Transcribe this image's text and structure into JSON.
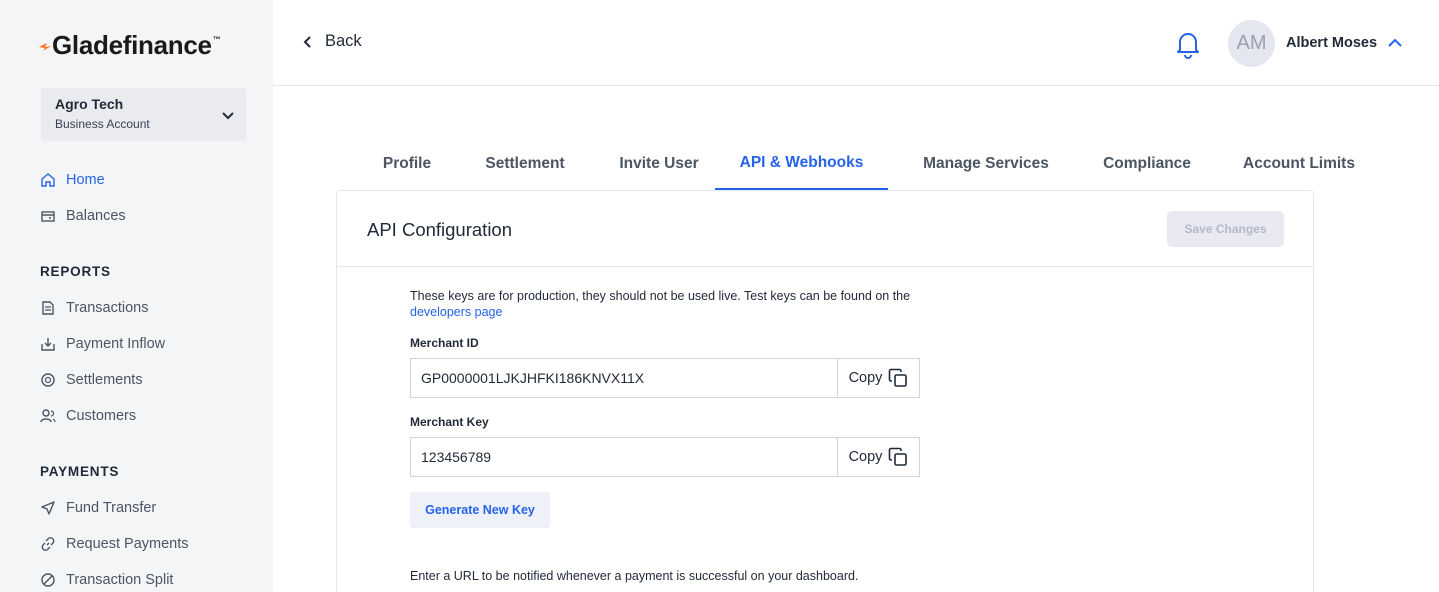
{
  "brand": {
    "name": "Gladefinance",
    "trademark": "™",
    "accent_color": "#2563eb",
    "logo_mark_color": "#f97316"
  },
  "account": {
    "name": "Agro Tech",
    "type": "Business Account"
  },
  "sidebar": {
    "main_items": [
      {
        "label": "Home",
        "icon": "home-icon",
        "active": true
      },
      {
        "label": "Balances",
        "icon": "wallet-icon",
        "active": false
      }
    ],
    "reports_title": "REPORTS",
    "reports_items": [
      {
        "label": "Transactions",
        "icon": "document-icon"
      },
      {
        "label": "Payment Inflow",
        "icon": "inbox-download-icon"
      },
      {
        "label": "Settlements",
        "icon": "coins-icon"
      },
      {
        "label": "Customers",
        "icon": "users-icon"
      }
    ],
    "payments_title": "PAYMENTS",
    "payments_items": [
      {
        "label": "Fund Transfer",
        "icon": "send-icon"
      },
      {
        "label": "Request Payments",
        "icon": "link-icon"
      },
      {
        "label": "Transaction Split",
        "icon": "split-icon"
      }
    ]
  },
  "header": {
    "back_label": "Back",
    "user": {
      "initials": "AM",
      "name": "Albert Moses"
    }
  },
  "tabs": [
    {
      "label": "Profile",
      "active": false
    },
    {
      "label": "Settlement",
      "active": false
    },
    {
      "label": "Invite User",
      "active": false
    },
    {
      "label": "API & Webhooks",
      "active": true
    },
    {
      "label": "Manage Services",
      "active": false
    },
    {
      "label": "Compliance",
      "active": false
    },
    {
      "label": "Account Limits",
      "active": false
    }
  ],
  "api_config": {
    "title": "API Configuration",
    "save_label": "Save Changes",
    "info_text": "These keys are for production, they should not be used live. Test keys can be found on the",
    "info_link": "developers page",
    "merchant_id_label": "Merchant ID",
    "merchant_id_value": "GP0000001LJKJHFKI186KNVX11X",
    "merchant_key_label": "Merchant Key",
    "merchant_key_value": "123456789",
    "copy_label": "Copy",
    "generate_label": "Generate New Key",
    "webhook_info": "Enter a URL to be notified whenever a payment is successful on your dashboard."
  }
}
